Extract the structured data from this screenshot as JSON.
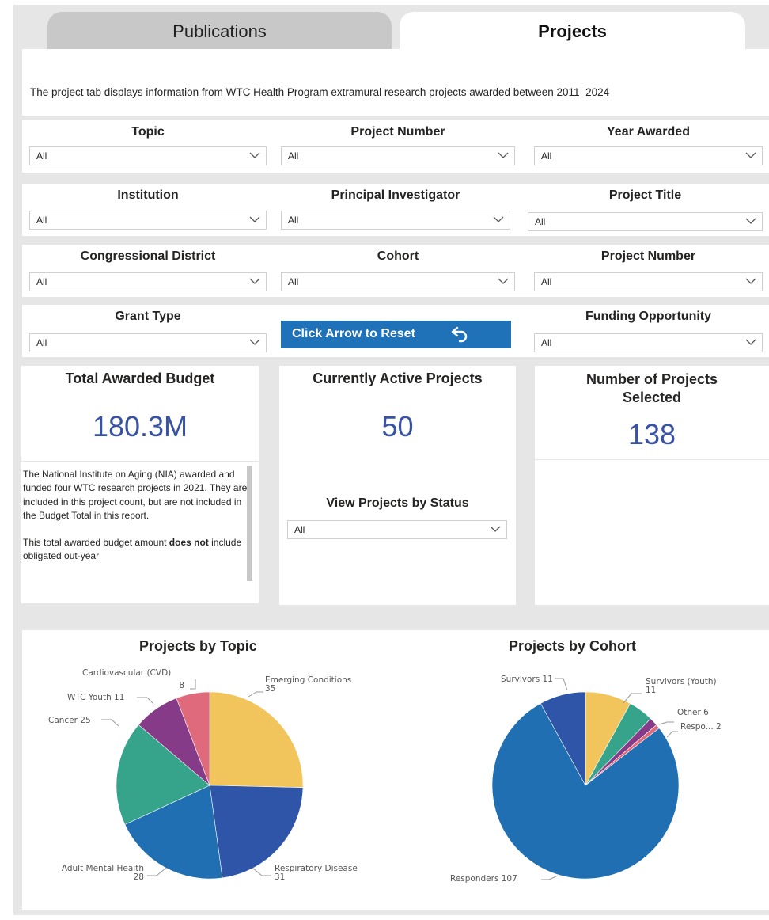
{
  "tabs": [
    {
      "label": "Publications"
    },
    {
      "label": "Projects"
    }
  ],
  "intro": "The project tab displays information from WTC Health Program extramural research projects awarded between 2011–2024",
  "filters": {
    "topic": {
      "label": "Topic",
      "value": "All"
    },
    "project_number": {
      "label": "Project Number",
      "value": "All"
    },
    "year_awarded": {
      "label": "Year Awarded",
      "value": "All"
    },
    "institution": {
      "label": "Institution",
      "value": "All"
    },
    "principal_investigator": {
      "label": "Principal Investigator",
      "value": "All"
    },
    "project_title": {
      "label": "Project Title",
      "value": "All"
    },
    "congressional_district": {
      "label": "Congressional District",
      "value": "All"
    },
    "cohort": {
      "label": "Cohort",
      "value": "All"
    },
    "project_number_2": {
      "label": "Project Number",
      "value": "All"
    },
    "grant_type": {
      "label": "Grant Type",
      "value": "All"
    },
    "funding_opportunity": {
      "label": "Funding Opportunity",
      "value": "All"
    }
  },
  "reset_button": {
    "label": "Click Arrow to Reset",
    "icon": "undo-arrow-icon"
  },
  "kpis": {
    "total_budget": {
      "title": "Total Awarded Budget",
      "value": "180.3M"
    },
    "active_projects": {
      "title": "Currently Active Projects",
      "value": "50"
    },
    "selected_projects": {
      "title_line1": "Number of Projects",
      "title_line2": "Selected",
      "value": "138"
    }
  },
  "budget_note": {
    "p1": "The National Institute on Aging (NIA) awarded and funded four WTC research projects in 2021. They are included in this project count, but are not included in the  Budget Total in this report.",
    "p2_before": "This total awarded budget amount ",
    "p2_bold": "does not",
    "p2_after": " include obligated out-year"
  },
  "status_filter": {
    "label": "View Projects by Status",
    "value": "All"
  },
  "colors": {
    "accent": "#1f72b8",
    "kpi_value": "#3953a4",
    "tab_inactive": "#c8c8c8",
    "panel_bg": "#e6e6e6"
  },
  "chart_data": [
    {
      "type": "pie",
      "title": "Projects by Topic",
      "slices": [
        {
          "label": "Emerging Conditions",
          "value": 35,
          "color": "#f2c55c"
        },
        {
          "label": "Respiratory Disease",
          "value": 31,
          "color": "#2e55a8"
        },
        {
          "label": "Adult Mental Health",
          "value": 28,
          "color": "#1f6fb2"
        },
        {
          "label": "Cancer",
          "value": 25,
          "color": "#35a48a"
        },
        {
          "label": "WTC Youth",
          "value": 11,
          "color": "#863b88"
        },
        {
          "label": "Cardiovascular (CVD)",
          "value": 8,
          "color": "#df6a7c"
        }
      ]
    },
    {
      "type": "pie",
      "title": "Projects by Cohort",
      "slices": [
        {
          "label": "Survivors (Youth)",
          "value": 11,
          "color": "#f2c55c"
        },
        {
          "label": "Other",
          "value": 6,
          "color": "#35a48a"
        },
        {
          "label": "Respo...",
          "value": 2,
          "color": "#863b88"
        },
        {
          "label": "",
          "value": 1,
          "color": "#df6a7c"
        },
        {
          "label": "Responders",
          "value": 107,
          "color": "#1f6fb2"
        },
        {
          "label": "Survivors",
          "value": 11,
          "color": "#2e55a8"
        }
      ]
    }
  ]
}
